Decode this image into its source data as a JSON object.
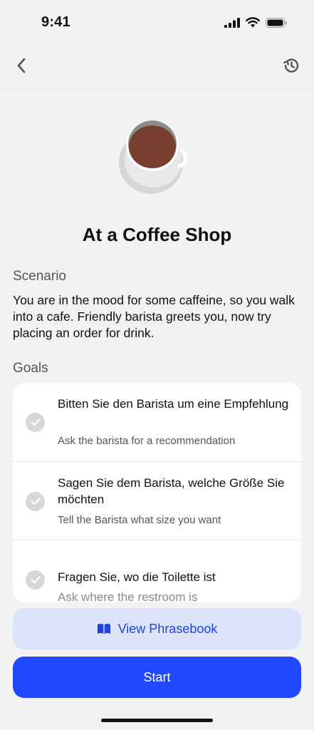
{
  "status": {
    "time": "9:41"
  },
  "nav": {
    "back_icon": "chevron-left-icon",
    "history_icon": "history-icon"
  },
  "colors": {
    "accent": "#1f48ff",
    "secondary_button_bg": "#dce3fb",
    "coffee": "#7a3e2e"
  },
  "title": "At a Coffee Shop",
  "scenario": {
    "label": "Scenario",
    "text": "You are in the mood for some caffeine, so you walk into a cafe. Friendly barista greets you, now try placing an order for drink."
  },
  "goals": {
    "label": "Goals",
    "items": [
      {
        "de": "Bitten Sie den Barista um eine Empfehlung",
        "en": "Ask the barista for a recommendation"
      },
      {
        "de": "Sagen Sie dem Barista, welche Größe Sie möchten",
        "en": "Tell the Barista what size you want"
      },
      {
        "de": "Fragen Sie, wo die Toilette ist",
        "en": "Ask where the restroom is"
      }
    ]
  },
  "buttons": {
    "phrasebook": "View Phrasebook",
    "start": "Start"
  }
}
